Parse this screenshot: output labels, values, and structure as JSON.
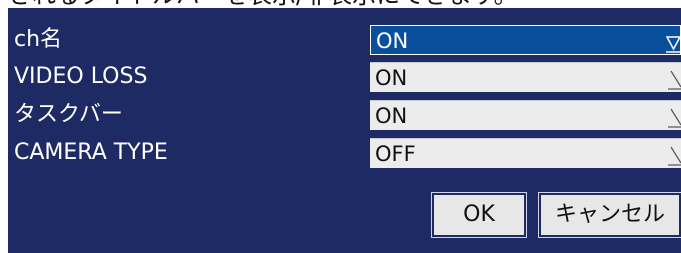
{
  "header": {
    "caption": "されるタイトルバーを表示/非表示にできます。"
  },
  "settings": [
    {
      "label": "ch名",
      "value": "ON",
      "active": true
    },
    {
      "label": "VIDEO LOSS",
      "value": "ON",
      "active": false
    },
    {
      "label": "タスクバー",
      "value": "ON",
      "active": false
    },
    {
      "label": "CAMERA TYPE",
      "value": "OFF",
      "active": false
    }
  ],
  "buttons": {
    "ok_label": "OK",
    "cancel_label": "キャンセル"
  },
  "colors": {
    "panel_background": "#1d2a63",
    "active_select": "#0a4f9c",
    "select_background": "#ececec",
    "label_text": "#ffffff"
  },
  "icons": {
    "dropdown": "triangle-down-icon"
  }
}
